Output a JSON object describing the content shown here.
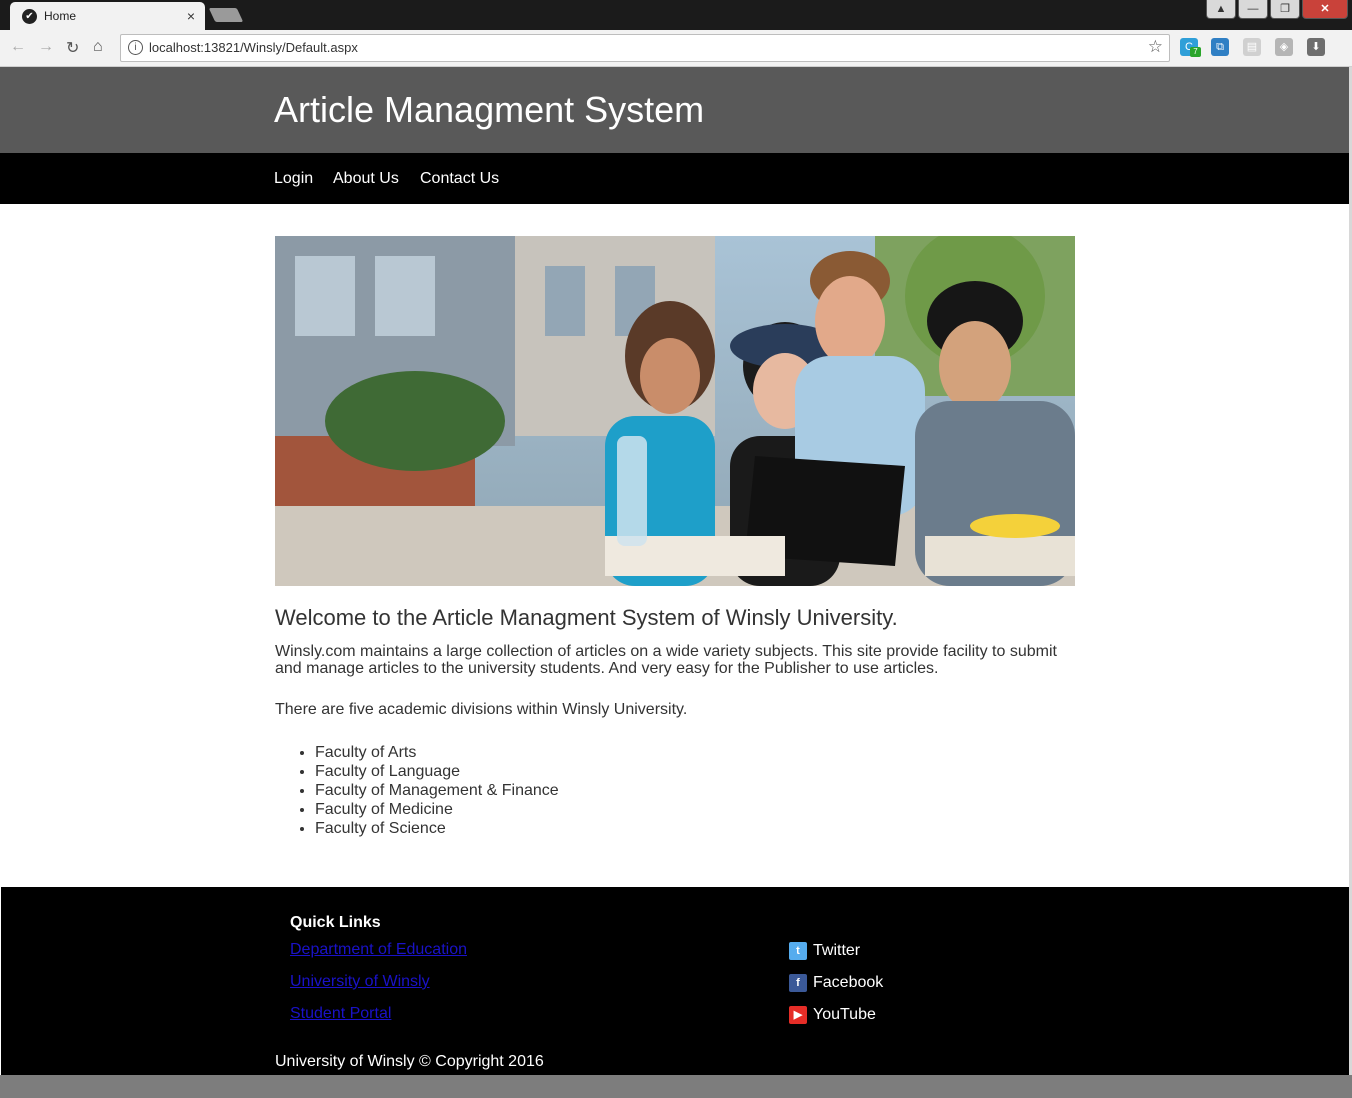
{
  "browser": {
    "tab_title": "Home",
    "tab_close": "×",
    "url": "localhost:13821/Winsly/Default.aspx",
    "extension_badge": "7",
    "window_buttons": [
      "▲",
      "—",
      "❐",
      "✕"
    ]
  },
  "header": {
    "title": "Article Managment System"
  },
  "nav": {
    "items": [
      {
        "label": "Login"
      },
      {
        "label": "About Us"
      },
      {
        "label": "Contact Us"
      }
    ]
  },
  "main": {
    "welcome": "Welcome to the Article Managment System of Winsly University.",
    "intro": "Winsly.com maintains a large collection of articles on a wide variety subjects. This site provide facility to submit and manage articles to the university students. And very easy for the Publisher to use articles.",
    "divisions_intro": "There are five academic divisions within Winsly University.",
    "faculties": [
      "Faculty of Arts",
      "Faculty of Language",
      "Faculty of Management & Finance",
      "Faculty of Medicine",
      "Faculty of Science"
    ]
  },
  "footer": {
    "quick_links_heading": "Quick Links",
    "quick_links": [
      "Department of Education",
      "University of Winsly",
      "Student Portal"
    ],
    "social": [
      {
        "label": "Twitter",
        "icon": "twitter-icon",
        "color": "#55acee"
      },
      {
        "label": "Facebook",
        "icon": "facebook-icon",
        "color": "#3b5998"
      },
      {
        "label": "YouTube",
        "icon": "youtube-icon",
        "color": "#e52d27"
      }
    ],
    "copyright": "University of Winsly © Copyright 2016"
  },
  "colors": {
    "header_bg": "#595959",
    "nav_bg": "#000000",
    "footer_bg": "#000000",
    "link": "#1a12c8"
  }
}
